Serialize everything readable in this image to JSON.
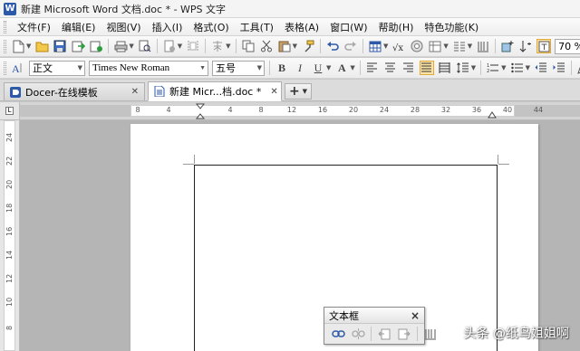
{
  "window": {
    "title": "新建 Microsoft Word 文档.doc * - WPS 文字",
    "logo_letter": "W"
  },
  "menu": [
    "文件(F)",
    "编辑(E)",
    "视图(V)",
    "插入(I)",
    "格式(O)",
    "工具(T)",
    "表格(A)",
    "窗口(W)",
    "帮助(H)",
    "特色功能(K)"
  ],
  "standard_toolbar": {
    "zoom": "70 %"
  },
  "format_toolbar": {
    "style": "正文",
    "font": "Times New Roman",
    "size": "五号",
    "bold": "B",
    "italic": "I",
    "underline": "U",
    "font_color": "A"
  },
  "tabs": [
    {
      "label": "Docer-在线模板",
      "active": false
    },
    {
      "label": "新建 Micr...档.doc *",
      "active": true
    }
  ],
  "new_tab_label": "+",
  "ruler": {
    "h_labels": [
      "8",
      "4",
      "",
      "4",
      "8",
      "12",
      "16",
      "20",
      "24",
      "28",
      "32",
      "36",
      "40",
      "44"
    ],
    "v_labels": [
      "24",
      "22",
      "20",
      "18",
      "16",
      "14",
      "12",
      "10",
      "8"
    ]
  },
  "floating_toolbar": {
    "title": "文本框",
    "close": "×"
  },
  "watermark": "头条 @纸鸟姐姐啊",
  "colors": {
    "accent": "#2d5aa8",
    "active_button": "#fbe3a6",
    "workspace": "#b5b5b5"
  }
}
